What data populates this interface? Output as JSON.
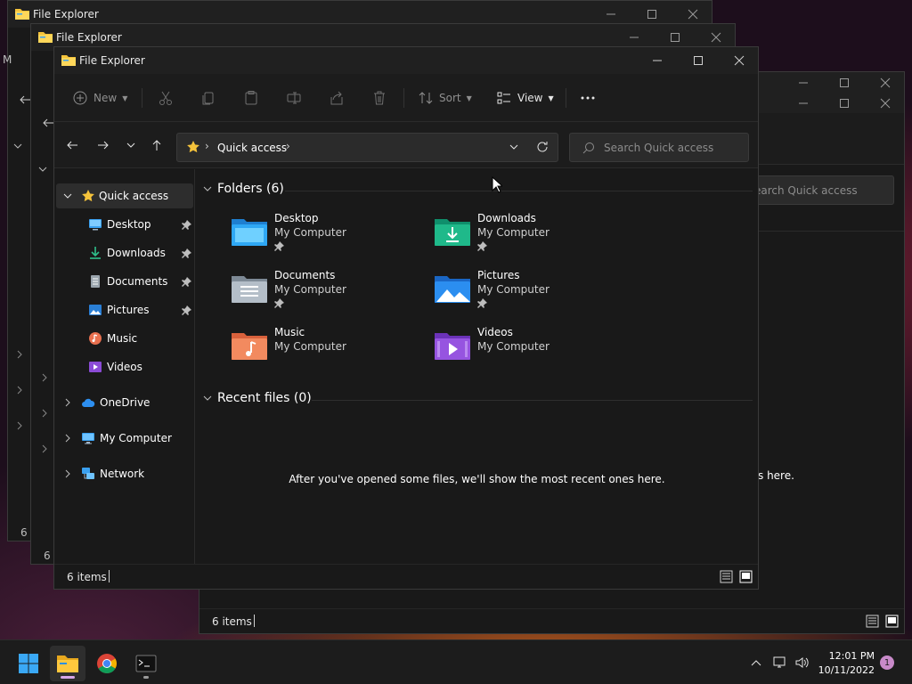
{
  "app_title": "File Explorer",
  "toolbar": {
    "new_label": "New",
    "sort_label": "Sort",
    "view_label": "View"
  },
  "address": {
    "location": "Quick access",
    "search_placeholder": "Search Quick access"
  },
  "sidebar": {
    "items": [
      {
        "label": "Quick access",
        "icon": "star-icon",
        "selected": true
      },
      {
        "label": "Desktop",
        "icon": "desktop-icon",
        "pinned": true
      },
      {
        "label": "Downloads",
        "icon": "download-icon",
        "pinned": true
      },
      {
        "label": "Documents",
        "icon": "document-icon",
        "pinned": true
      },
      {
        "label": "Pictures",
        "icon": "pictures-icon",
        "pinned": true
      },
      {
        "label": "Music",
        "icon": "music-icon"
      },
      {
        "label": "Videos",
        "icon": "video-icon"
      },
      {
        "label": "OneDrive",
        "icon": "cloud-icon"
      },
      {
        "label": "My Computer",
        "icon": "computer-icon"
      },
      {
        "label": "Network",
        "icon": "network-icon"
      }
    ]
  },
  "folders": {
    "heading": "Folders (6)",
    "items": [
      {
        "name": "Desktop",
        "location": "My Computer",
        "pinned": true,
        "icon": "desktop-folder-icon"
      },
      {
        "name": "Downloads",
        "location": "My Computer",
        "pinned": true,
        "icon": "downloads-folder-icon"
      },
      {
        "name": "Documents",
        "location": "My Computer",
        "pinned": true,
        "icon": "documents-folder-icon"
      },
      {
        "name": "Pictures",
        "location": "My Computer",
        "pinned": true,
        "icon": "pictures-folder-icon"
      },
      {
        "name": "Music",
        "location": "My Computer",
        "pinned": false,
        "icon": "music-folder-icon"
      },
      {
        "name": "Videos",
        "location": "My Computer",
        "pinned": false,
        "icon": "videos-folder-icon"
      }
    ]
  },
  "recent": {
    "heading": "Recent files (0)",
    "empty_message": "After you've opened some files, we'll show the most recent ones here."
  },
  "status": {
    "items_count": "6 items"
  },
  "background_windows": {
    "title_1": "File Explorer",
    "title_2": "File Explorer",
    "fragment_m": "M",
    "fragment_6i_1": "6 i",
    "fragment_6i_2": "6 i",
    "right_search_fragment": "earch Quick access",
    "right_msg_fragment": "s here.",
    "right_status": "6 items"
  },
  "taskbar": {
    "time": "12:01 PM",
    "date": "10/11/2022",
    "notification_count": "1"
  },
  "colors": {
    "accent_folder": "#f5c33b",
    "accent_blue": "#3aa0f0",
    "window_bg": "#191919"
  }
}
